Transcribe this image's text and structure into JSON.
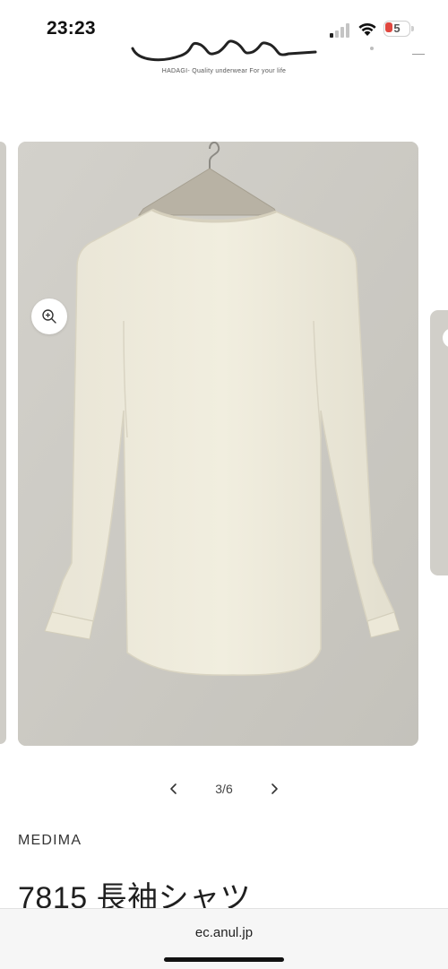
{
  "status_bar": {
    "time": "23:23",
    "battery": "5",
    "battery_color": "#e0473f"
  },
  "header": {
    "tagline": "HADAGI- Quality underwear For your life"
  },
  "gallery": {
    "pager_text": "3/6",
    "prev_icon": "chevron-left-icon",
    "next_icon": "chevron-right-icon",
    "zoom_icon": "zoom-in-icon"
  },
  "product": {
    "brand": "MEDIMA",
    "title": "7815 長袖シャツ"
  },
  "browser": {
    "url": "ec.anul.jp"
  }
}
